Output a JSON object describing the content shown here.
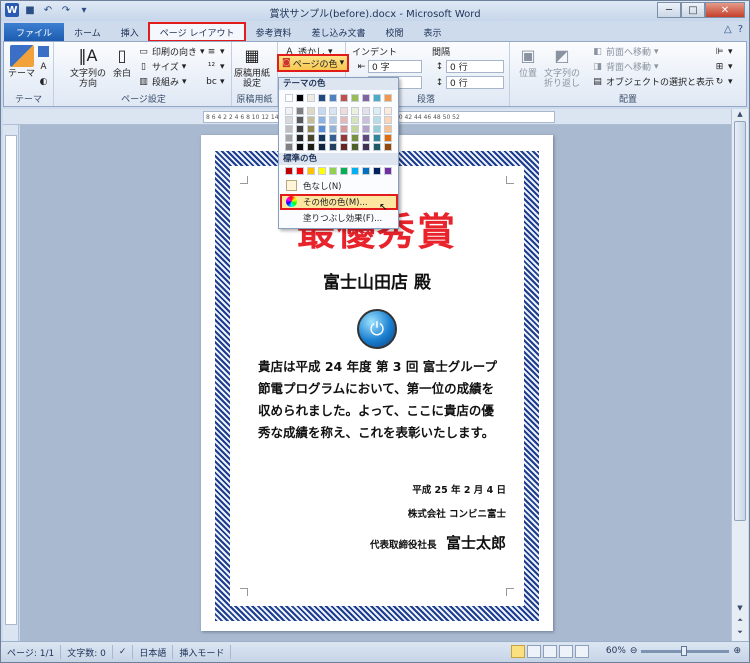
{
  "window": {
    "title": "賞状サンプル(before).docx - Microsoft Word",
    "minimize": "─",
    "maximize": "□",
    "close": "✕",
    "app_icon": "W"
  },
  "tabs": [
    {
      "label": "ファイル"
    },
    {
      "label": "ホーム"
    },
    {
      "label": "挿入"
    },
    {
      "label": "ページ レイアウト"
    },
    {
      "label": "参考資料"
    },
    {
      "label": "差し込み文書"
    },
    {
      "label": "校閲"
    },
    {
      "label": "表示"
    }
  ],
  "ribbon": {
    "theme": {
      "theme_btn": "テーマ",
      "group": "テーマ"
    },
    "page_setup": {
      "text_direction": "文字列の\n方向",
      "margins": "余白",
      "orientation": "印刷の向き",
      "size": "サイズ",
      "columns": "段組み",
      "group": "ページ設定"
    },
    "genko": {
      "btn": "原稿用紙\n設定",
      "group": "原稿用紙"
    },
    "page_bg": {
      "watermark": "透かし",
      "page_color": "ページの色"
    },
    "paragraph": {
      "indent": "インデント",
      "spacing": "間隔",
      "left_val": "0 字",
      "right_val": "0 字",
      "before_val": "0 行",
      "after_val": "0 行",
      "group": "段落"
    },
    "arrange": {
      "position": "位置",
      "wrap": "文字列の\n折り返し",
      "bring_forward": "前面へ移動",
      "send_backward": "背面へ移動",
      "selection": "オブジェクトの選択と表示",
      "group": "配置"
    }
  },
  "dropdown": {
    "theme_colors": "テーマの色",
    "standard_colors": "標準の色",
    "no_color": "色なし(N)",
    "more_colors": "その他の色(M)...",
    "fill_effects": "塗りつぶし効果(F)...",
    "theme_palette": [
      [
        "#ffffff",
        "#000000",
        "#eeece1",
        "#1f497d",
        "#4f81bd",
        "#c0504d",
        "#9bbb59",
        "#8064a2",
        "#4bacc6",
        "#f79646"
      ],
      [
        "#f2f2f2",
        "#7f7f7f",
        "#ddd9c3",
        "#c6d9f0",
        "#dbe5f1",
        "#f2dcdb",
        "#ebf1dd",
        "#e5e0ec",
        "#dbeef3",
        "#fdeada"
      ],
      [
        "#d8d8d8",
        "#595959",
        "#c4bd97",
        "#8db3e2",
        "#b8cce4",
        "#e5b9b7",
        "#d7e3bc",
        "#ccc1d9",
        "#b7dde8",
        "#fbd5b5"
      ],
      [
        "#bfbfbf",
        "#3f3f3f",
        "#938953",
        "#548dd4",
        "#95b3d7",
        "#d99694",
        "#c3d69b",
        "#b2a2c7",
        "#92cddc",
        "#fac08f"
      ],
      [
        "#a5a5a5",
        "#262626",
        "#494429",
        "#17365d",
        "#366092",
        "#953734",
        "#76923c",
        "#5f497a",
        "#31859b",
        "#e36c09"
      ],
      [
        "#7f7f7f",
        "#0c0c0c",
        "#1d1b10",
        "#0f243e",
        "#244061",
        "#632423",
        "#4f6128",
        "#3f3151",
        "#205867",
        "#974806"
      ]
    ],
    "standard_palette": [
      "#c00000",
      "#ff0000",
      "#ffc000",
      "#ffff00",
      "#92d050",
      "#00b050",
      "#00b0f0",
      "#0070c0",
      "#002060",
      "#7030a0"
    ]
  },
  "ruler_text": "8  6  4  2     2  4  6  8  10  12  14  16  18  20  22  24  26  28  30  32  34  36  38  40  42  44  46  48  50  52",
  "document": {
    "title": "最優秀賞",
    "recipient": "富士山田店 殿",
    "body": "貴店は平成 24 年度 第 3 回 富士グループ節電プログラムにおいて、第一位の成績を収められました。よって、ここに貴店の優秀な成績を称え、これを表彰いたします。",
    "date": "平成 25 年 2 月 4 日",
    "company": "株式会社 コンビニ富士",
    "rep_title": "代表取締役社長",
    "rep_name": "富士太郎",
    "para_mark": "↵"
  },
  "statusbar": {
    "page": "ページ: 1/1",
    "words": "文字数: 0",
    "lang": "日本語",
    "mode": "挿入モード",
    "zoom": "60%"
  }
}
